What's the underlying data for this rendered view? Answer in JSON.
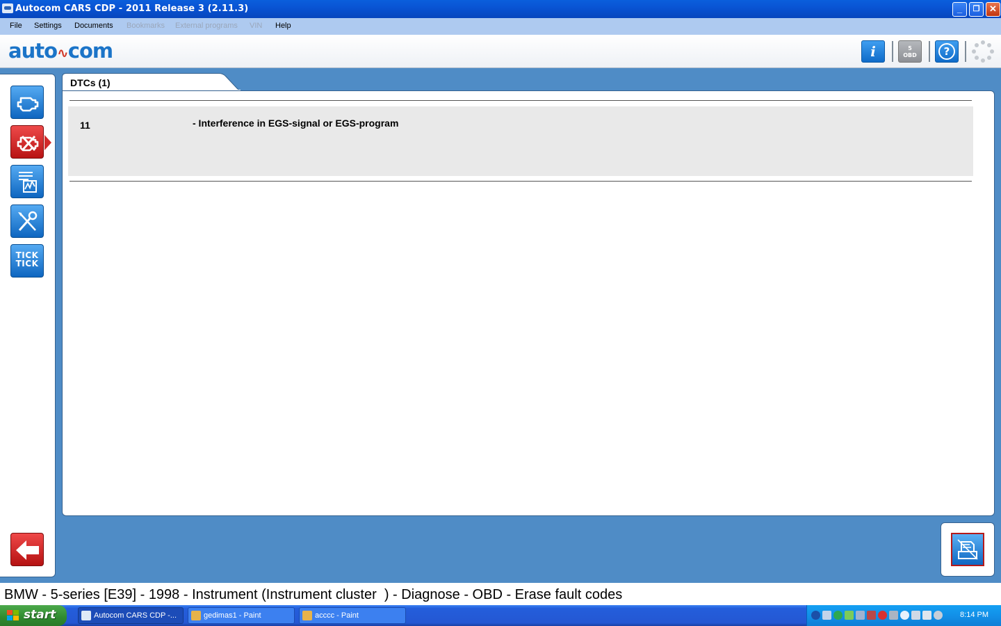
{
  "window": {
    "title": "Autocom CARS CDP - 2011 Release 3 (2.11.3)",
    "controls": {
      "minimize": "_",
      "restore": "❐",
      "close": "✕"
    }
  },
  "menu": {
    "items": [
      {
        "label": "File",
        "enabled": true
      },
      {
        "label": "Settings",
        "enabled": true
      },
      {
        "label": "Documents",
        "enabled": true
      },
      {
        "label": "Bookmarks",
        "enabled": false
      },
      {
        "label": "External programs",
        "enabled": false
      },
      {
        "label": "VIN",
        "enabled": false
      },
      {
        "label": "Help",
        "enabled": true
      }
    ]
  },
  "header": {
    "logo_left": "auto",
    "logo_mark": "∿",
    "logo_right": "com",
    "toolbar": {
      "info_label": "i",
      "obd_top": "5",
      "obd_bottom": "OBD",
      "help_label": "?"
    }
  },
  "sidebar": {
    "items": [
      {
        "name": "engine",
        "icon": "engine-icon",
        "active": false
      },
      {
        "name": "fault-codes",
        "icon": "engine-fault-icon",
        "active": true
      },
      {
        "name": "live-data",
        "icon": "graph-icon",
        "active": false
      },
      {
        "name": "tools",
        "icon": "tools-icon",
        "active": false
      },
      {
        "name": "tick-tick",
        "icon": "tick-tick-icon",
        "active": false,
        "text_top": "TICK",
        "text_bottom": "TICK"
      }
    ]
  },
  "panel": {
    "tab_label": "DTCs (1)",
    "dtcs": [
      {
        "code": "11",
        "description": "- Interference in EGS-signal or EGS-program"
      }
    ]
  },
  "breadcrumb": "BMW - 5-series [E39] - 1998 - Instrument (Instrument cluster  ) - Diagnose - OBD - Erase fault codes",
  "taskbar": {
    "start_label": "start",
    "tasks": [
      {
        "label": "Autocom CARS CDP -...",
        "active": true
      },
      {
        "label": "gedimas1 - Paint",
        "active": false
      },
      {
        "label": "acccc - Paint",
        "active": false
      }
    ],
    "clock": "8:14 PM"
  },
  "colors": {
    "background": "#4f8cc6",
    "accent_blue": "#0e66c0",
    "active_red": "#c81c1c",
    "dtc_row": "#e9e9e9"
  }
}
